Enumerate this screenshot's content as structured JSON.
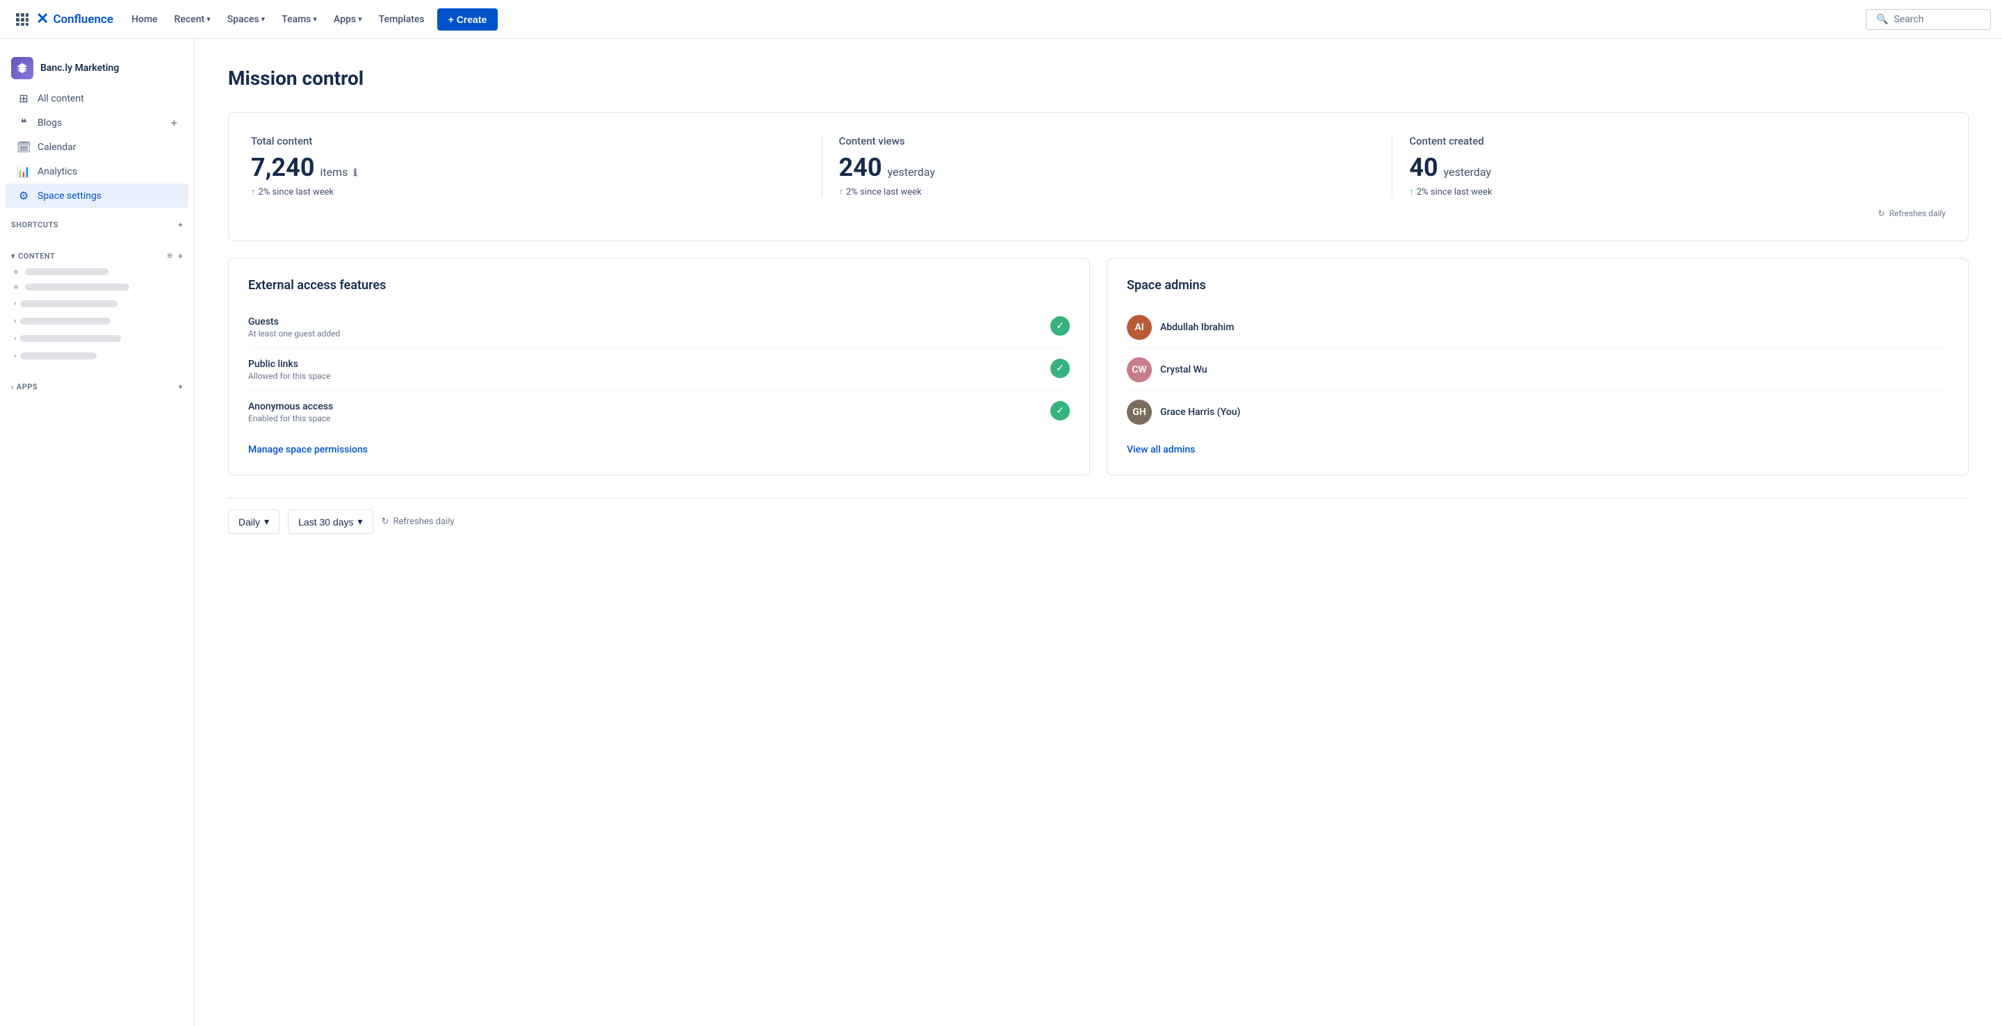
{
  "topnav": {
    "logo_text": "Confluence",
    "home_label": "Home",
    "recent_label": "Recent",
    "spaces_label": "Spaces",
    "teams_label": "Teams",
    "apps_label": "Apps",
    "templates_label": "Templates",
    "create_label": "+ Create",
    "search_placeholder": "Search"
  },
  "sidebar": {
    "space_name": "Banc.ly Marketing",
    "items": [
      {
        "id": "all-content",
        "label": "All content",
        "icon": "⊞"
      },
      {
        "id": "blogs",
        "label": "Blogs",
        "icon": "❝"
      },
      {
        "id": "calendar",
        "label": "Calendar",
        "icon": "📅"
      },
      {
        "id": "analytics",
        "label": "Analytics",
        "icon": "📊"
      },
      {
        "id": "space-settings",
        "label": "Space settings",
        "icon": "⚙",
        "active": true
      }
    ],
    "shortcuts_label": "SHORTCUTS",
    "content_label": "CONTENT",
    "apps_label": "APPS",
    "content_items": [
      {
        "type": "bullet",
        "width": 120
      },
      {
        "type": "bullet",
        "width": 150
      },
      {
        "type": "arrow",
        "width": 140
      },
      {
        "type": "arrow",
        "width": 130
      },
      {
        "type": "arrow",
        "width": 145
      },
      {
        "type": "arrow",
        "width": 110
      }
    ]
  },
  "main": {
    "page_title": "Mission control",
    "stats": {
      "total_content": {
        "label": "Total content",
        "value": "7,240",
        "unit": "items",
        "change": "2% since last week"
      },
      "content_views": {
        "label": "Content views",
        "value": "240",
        "unit": "yesterday",
        "change": "2% since last week"
      },
      "content_created": {
        "label": "Content created",
        "value": "40",
        "unit": "yesterday",
        "change": "2% since last week"
      },
      "refreshes_daily": "Refreshes daily"
    },
    "external_access": {
      "title": "External access features",
      "items": [
        {
          "name": "Guests",
          "desc": "At least one guest added",
          "enabled": true
        },
        {
          "name": "Public links",
          "desc": "Allowed for this space",
          "enabled": true
        },
        {
          "name": "Anonymous access",
          "desc": "Enabled for this space",
          "enabled": true
        }
      ],
      "manage_link": "Manage space permissions"
    },
    "space_admins": {
      "title": "Space admins",
      "admins": [
        {
          "name": "Abdullah Ibrahim",
          "color": "#b85c38",
          "initials": "AI"
        },
        {
          "name": "Crystal Wu",
          "color": "#c97c8a",
          "initials": "CW"
        },
        {
          "name": "Grace Harris (You)",
          "color": "#7b6c5c",
          "initials": "GH"
        }
      ],
      "view_all_link": "View all admins"
    },
    "bottom_bar": {
      "daily_label": "Daily",
      "last_30_label": "Last 30 days",
      "refresh_label": "Refreshes daily"
    }
  }
}
